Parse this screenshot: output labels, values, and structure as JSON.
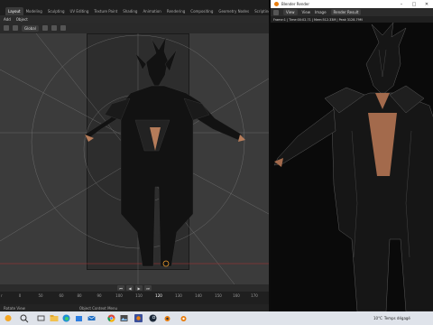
{
  "blender": {
    "workspace_tabs": [
      "Layout",
      "Modeling",
      "Sculpting",
      "UV Editing",
      "Texture Paint",
      "Shading",
      "Animation",
      "Rendering",
      "Compositing",
      "Geometry Nodes",
      "Scripting",
      "+"
    ],
    "active_tab": "Layout",
    "menu": [
      "Add",
      "Object"
    ],
    "viewport_header": {
      "transform_orientation": "Global"
    },
    "timeline": {
      "header_label": "",
      "ticks": [
        "0",
        "20",
        "40",
        "50",
        "60",
        "80",
        "90",
        "100",
        "110",
        "120",
        "130",
        "140",
        "150",
        "160",
        "170",
        "180"
      ],
      "current_frame": "120",
      "left_label": "r"
    },
    "statusbar": {
      "left": "Rotate View",
      "center": "Object Context Menu"
    },
    "colors": {
      "accent": "#3d6fb5",
      "viewport_bg": "#3b3b3b",
      "camera_frame": "#2d2d2d",
      "annotation_line": "#e0e0e0",
      "origin_marker": "#f0a030"
    }
  },
  "render_window": {
    "title": "Blender Render",
    "menu": [
      "View",
      "View",
      "Image",
      "Render Result"
    ],
    "info": "Frame:1 | Time:00:02.71 | Mem:512.33M | Peak 3128.79M"
  },
  "taskbar": {
    "weather_temp": "10°C",
    "weather_text": "Temps dégagé",
    "icons": [
      "search-icon",
      "task-view-icon",
      "file-explorer-icon",
      "edge-icon",
      "chrome-icon",
      "store-icon",
      "steam-icon",
      "blender-icon",
      "mail-icon",
      "photos-icon"
    ]
  }
}
